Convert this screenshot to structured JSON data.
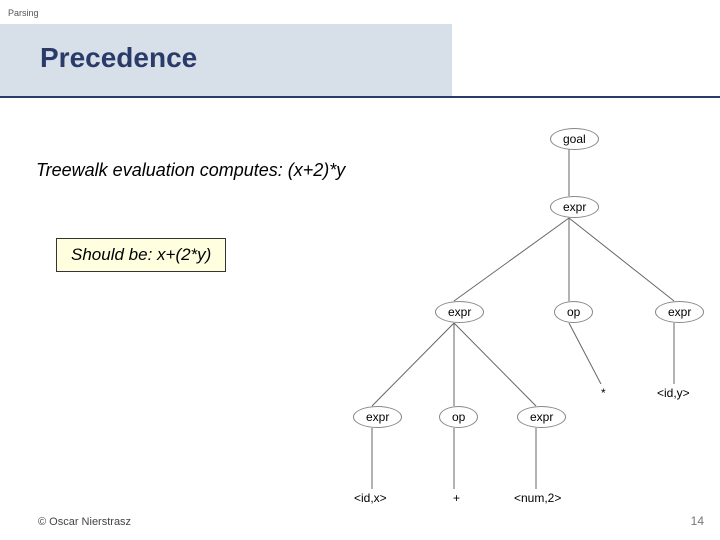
{
  "topic": "Parsing",
  "title": "Precedence",
  "sentence": "Treewalk evaluation computes: (x+2)*y",
  "callout": "Should be: x+(2*y)",
  "footer": "© Oscar Nierstrasz",
  "page_number": "14",
  "tree": {
    "n1": "goal",
    "n2": "expr",
    "n3": "expr",
    "n4": "op",
    "n5": "expr",
    "n6": "expr",
    "n7": "op",
    "n8": "expr",
    "n9": "*",
    "n10": "<id,y>",
    "n11": "<id,x>",
    "n12": "+",
    "n13": "<num,2>"
  }
}
